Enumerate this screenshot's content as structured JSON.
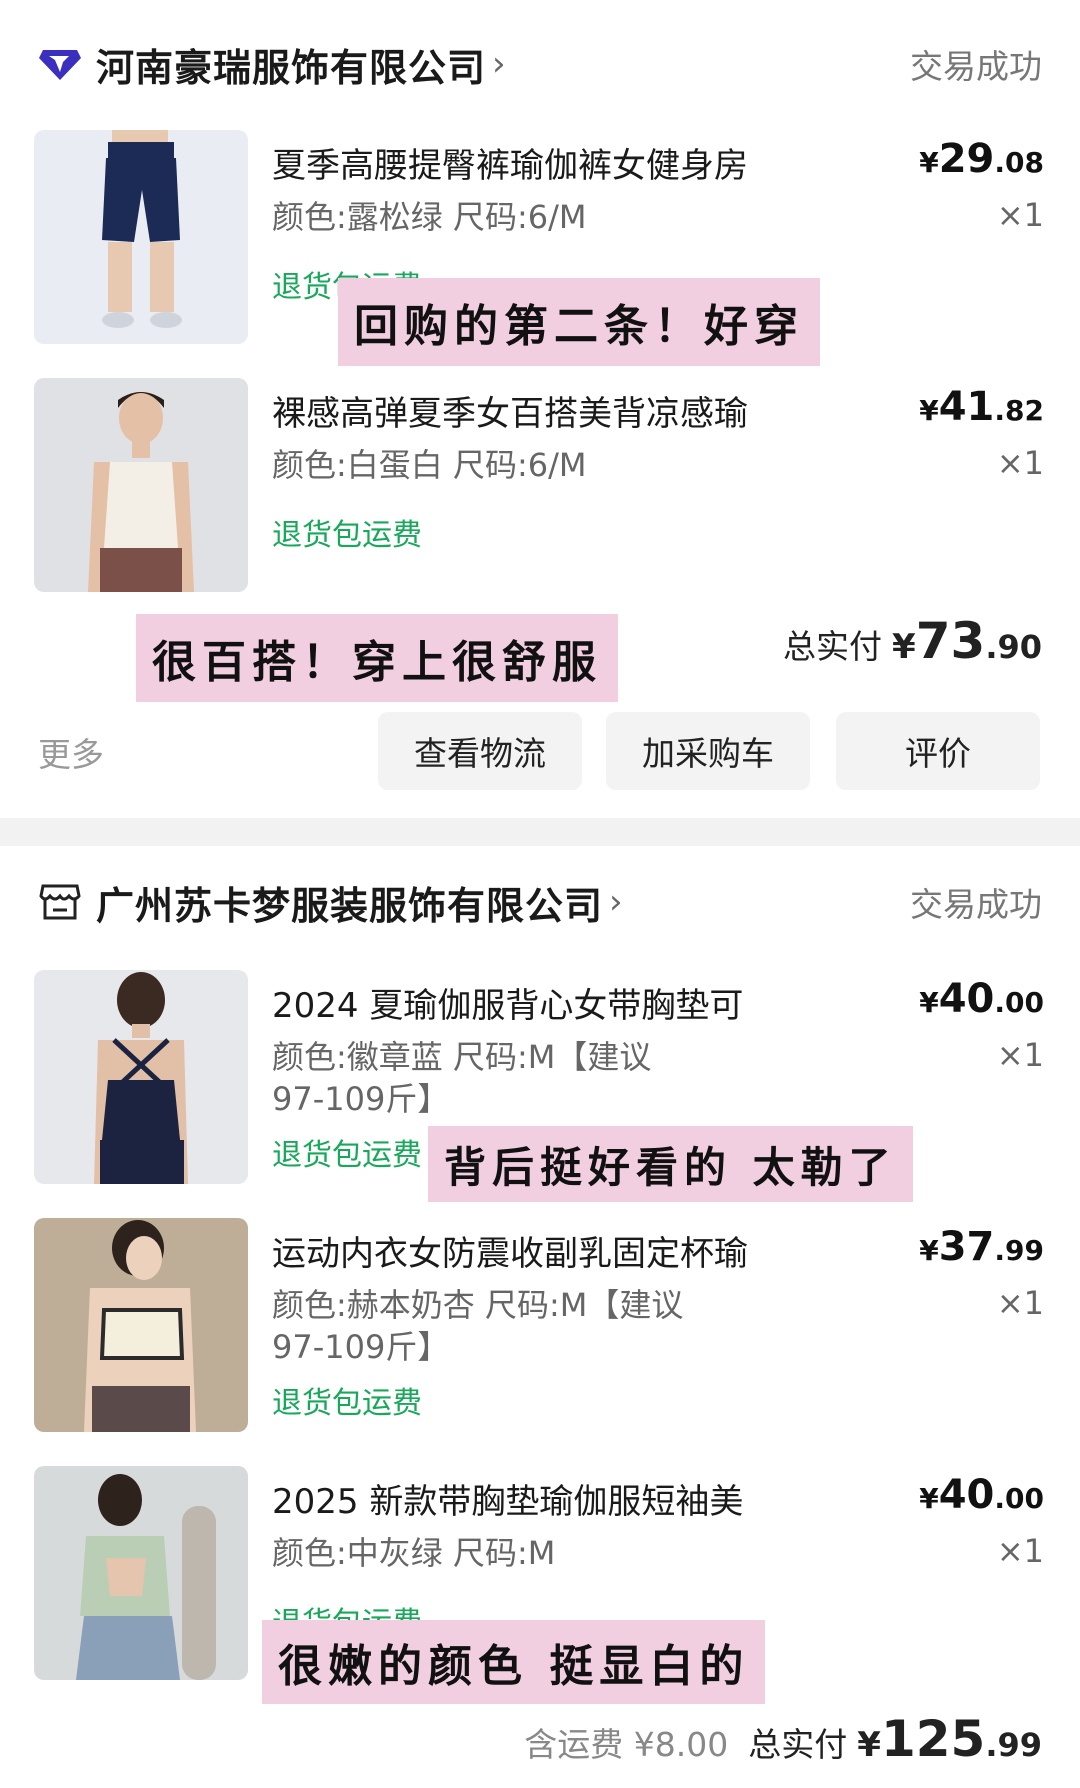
{
  "orders": [
    {
      "shop_name": "河南豪瑞服饰有限公司",
      "status": "交易成功",
      "items": [
        {
          "title": "夏季高腰提臀裤瑜伽裤女健身房",
          "spec": "颜色:露松绿 尺码:6/M",
          "tag": "退货包运费",
          "price_currency": "¥",
          "price_int": "29",
          "price_dec": ".08",
          "qty": "×1"
        },
        {
          "title": "裸感高弹夏季女百搭美背凉感瑜",
          "spec": "颜色:白蛋白 尺码:6/M",
          "tag": "退货包运费",
          "price_currency": "¥",
          "price_int": "41",
          "price_dec": ".82",
          "qty": "×1"
        }
      ],
      "total_label": "总实付",
      "total_currency": "¥",
      "total_int": "73",
      "total_dec": ".90",
      "more_label": "更多",
      "buttons": [
        "查看物流",
        "加采购车",
        "评价"
      ]
    },
    {
      "shop_name": "广州苏卡梦服装服饰有限公司",
      "status": "交易成功",
      "items": [
        {
          "title": "2024 夏瑜伽服背心女带胸垫可",
          "spec": "颜色:徽章蓝 尺码:M【建议 97-109斤】",
          "tag": "退货包运费",
          "price_currency": "¥",
          "price_int": "40",
          "price_dec": ".00",
          "qty": "×1"
        },
        {
          "title": "运动内衣女防震收副乳固定杯瑜",
          "spec": "颜色:赫本奶杏 尺码:M【建议 97-109斤】",
          "tag": "退货包运费",
          "price_currency": "¥",
          "price_int": "37",
          "price_dec": ".99",
          "qty": "×1"
        },
        {
          "title": "2025 新款带胸垫瑜伽服短袖美",
          "spec": "颜色:中灰绿 尺码:M",
          "tag": "退货包运费",
          "price_currency": "¥",
          "price_int": "40",
          "price_dec": ".00",
          "qty": "×1"
        }
      ],
      "shipping_label": "含运费 ¥8.00",
      "total_label": "总实付",
      "total_currency": "¥",
      "total_int": "125",
      "total_dec": ".99"
    }
  ],
  "annotations": {
    "note_1": "回购的第二条！好穿",
    "note_2": "很百搭！穿上很舒服",
    "note_3": "背后挺好看的 太勒了",
    "note_4": "很嫩的颜色 挺显白的"
  },
  "icons": {
    "shop_1_logo": "diamond-logo-icon",
    "shop_2_logo": "storefront-icon",
    "chevron": "chevron-right-icon"
  },
  "colors": {
    "accent_green": "#18a85a",
    "note_bg": "#f2cfe0",
    "logo_purple": "#3b2fbf"
  }
}
